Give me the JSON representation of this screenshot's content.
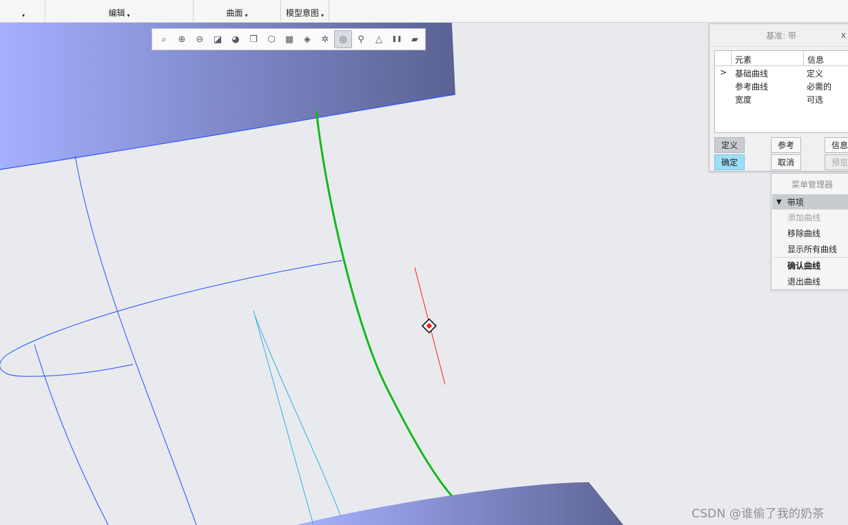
{
  "ribbon": {
    "groups": [
      {
        "label": "",
        "caret": "▾"
      },
      {
        "label": "编辑",
        "caret": "▾"
      },
      {
        "label": "曲面",
        "caret": "▾"
      },
      {
        "label": "模型意图",
        "caret": "▾"
      }
    ]
  },
  "graphics_toolbar": {
    "buttons": [
      {
        "icon": "zoom-fit-icon",
        "glyph": "⌕"
      },
      {
        "icon": "zoom-in-icon",
        "glyph": "⊕"
      },
      {
        "icon": "zoom-out-icon",
        "glyph": "⊖"
      },
      {
        "icon": "repaint-icon",
        "glyph": "◪"
      },
      {
        "icon": "display-style-icon",
        "glyph": "◕"
      },
      {
        "icon": "saved-views-icon",
        "glyph": "❒"
      },
      {
        "icon": "view-manager-icon",
        "glyph": "⬡"
      },
      {
        "icon": "perspective-icon",
        "glyph": "▦"
      },
      {
        "icon": "named-view-icon",
        "glyph": "◈"
      },
      {
        "icon": "datum-display-icon",
        "glyph": "✲"
      },
      {
        "icon": "spin-center-icon",
        "glyph": "◎",
        "active": true
      },
      {
        "icon": "annotation-display-icon",
        "glyph": "⚲"
      },
      {
        "icon": "sketch-display-icon",
        "glyph": "△"
      },
      {
        "icon": "pause-icon",
        "glyph": "❚❚"
      },
      {
        "icon": "appearance-icon",
        "glyph": "▰"
      }
    ]
  },
  "dialog": {
    "title": "基准: 带",
    "close": "x",
    "columns": {
      "element": "元素",
      "info": "信息"
    },
    "rows": [
      {
        "marker": ">",
        "element": "基础曲线",
        "info": "定义"
      },
      {
        "marker": "",
        "element": "参考曲线",
        "info": "必需的"
      },
      {
        "marker": "",
        "element": "宽度",
        "info": "可选"
      }
    ],
    "buttons": {
      "define": "定义",
      "refs": "参考",
      "info": "信息",
      "ok": "确定",
      "cancel": "取消",
      "preview": "预览"
    }
  },
  "menu_manager": {
    "title": "菜单管理器",
    "section": "带项",
    "items": [
      {
        "label": "添加曲线",
        "disabled": true
      },
      {
        "label": "移除曲线"
      },
      {
        "label": "显示所有曲线"
      },
      {
        "label": "确认曲线",
        "bold": true
      },
      {
        "label": "退出曲线"
      }
    ]
  },
  "watermark": "CSDN @谁偷了我的奶茶",
  "colors": {
    "surface_light": "#a4b0ff",
    "surface_dark": "#5a6293",
    "selected_curve": "#12b81a",
    "edge_blue": "#1f4fff",
    "edge_cyan": "#2ab0e6",
    "datum_red": "#ff1a1a"
  }
}
